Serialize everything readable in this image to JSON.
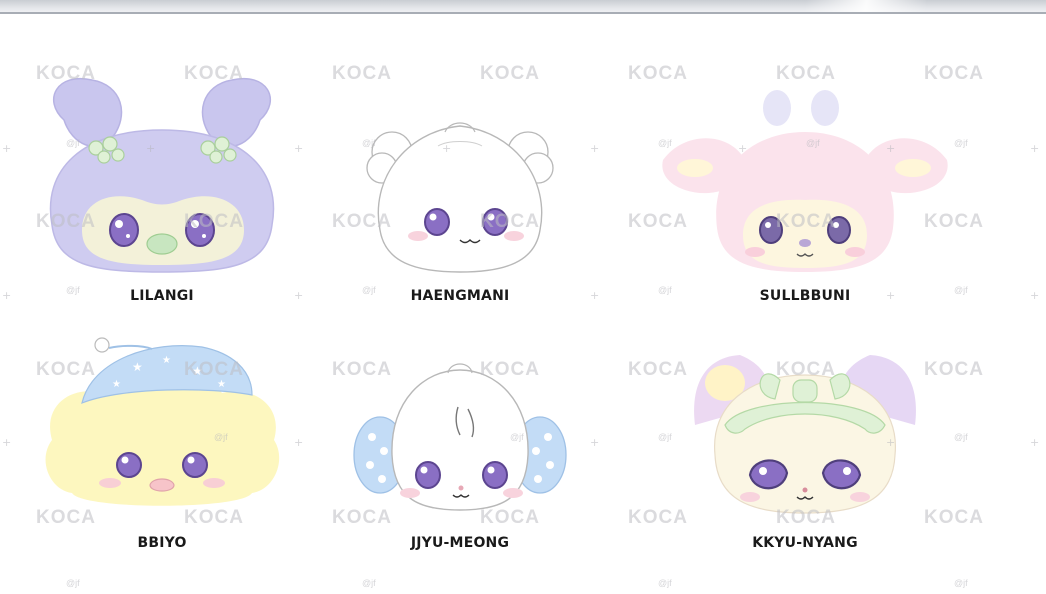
{
  "watermark": {
    "logo_text": "KOCA",
    "small_mark": "@jf"
  },
  "characters": [
    {
      "name": "LILANGI",
      "icon": "lilangi-icon"
    },
    {
      "name": "HAENGMANI",
      "icon": "haengmani-icon"
    },
    {
      "name": "SULLBBUNI",
      "icon": "sullbbuni-icon"
    },
    {
      "name": "BBIYO",
      "icon": "bbiyo-icon"
    },
    {
      "name": "JJYU-MEONG",
      "icon": "jjyu-meong-icon"
    },
    {
      "name": "KKYU-NYANG",
      "icon": "kkyu-nyang-icon"
    }
  ],
  "colors": {
    "lilangi": "#c9c6ee",
    "haengmani": "#ffffff",
    "sullbbuni": "#fbe3ec",
    "bbiyo": "#fdf7bf",
    "jjyu_meong_ears": "#c3dcf6",
    "kkyu_nyang": "#fbf6e4",
    "eye": "#8a6fc4"
  }
}
